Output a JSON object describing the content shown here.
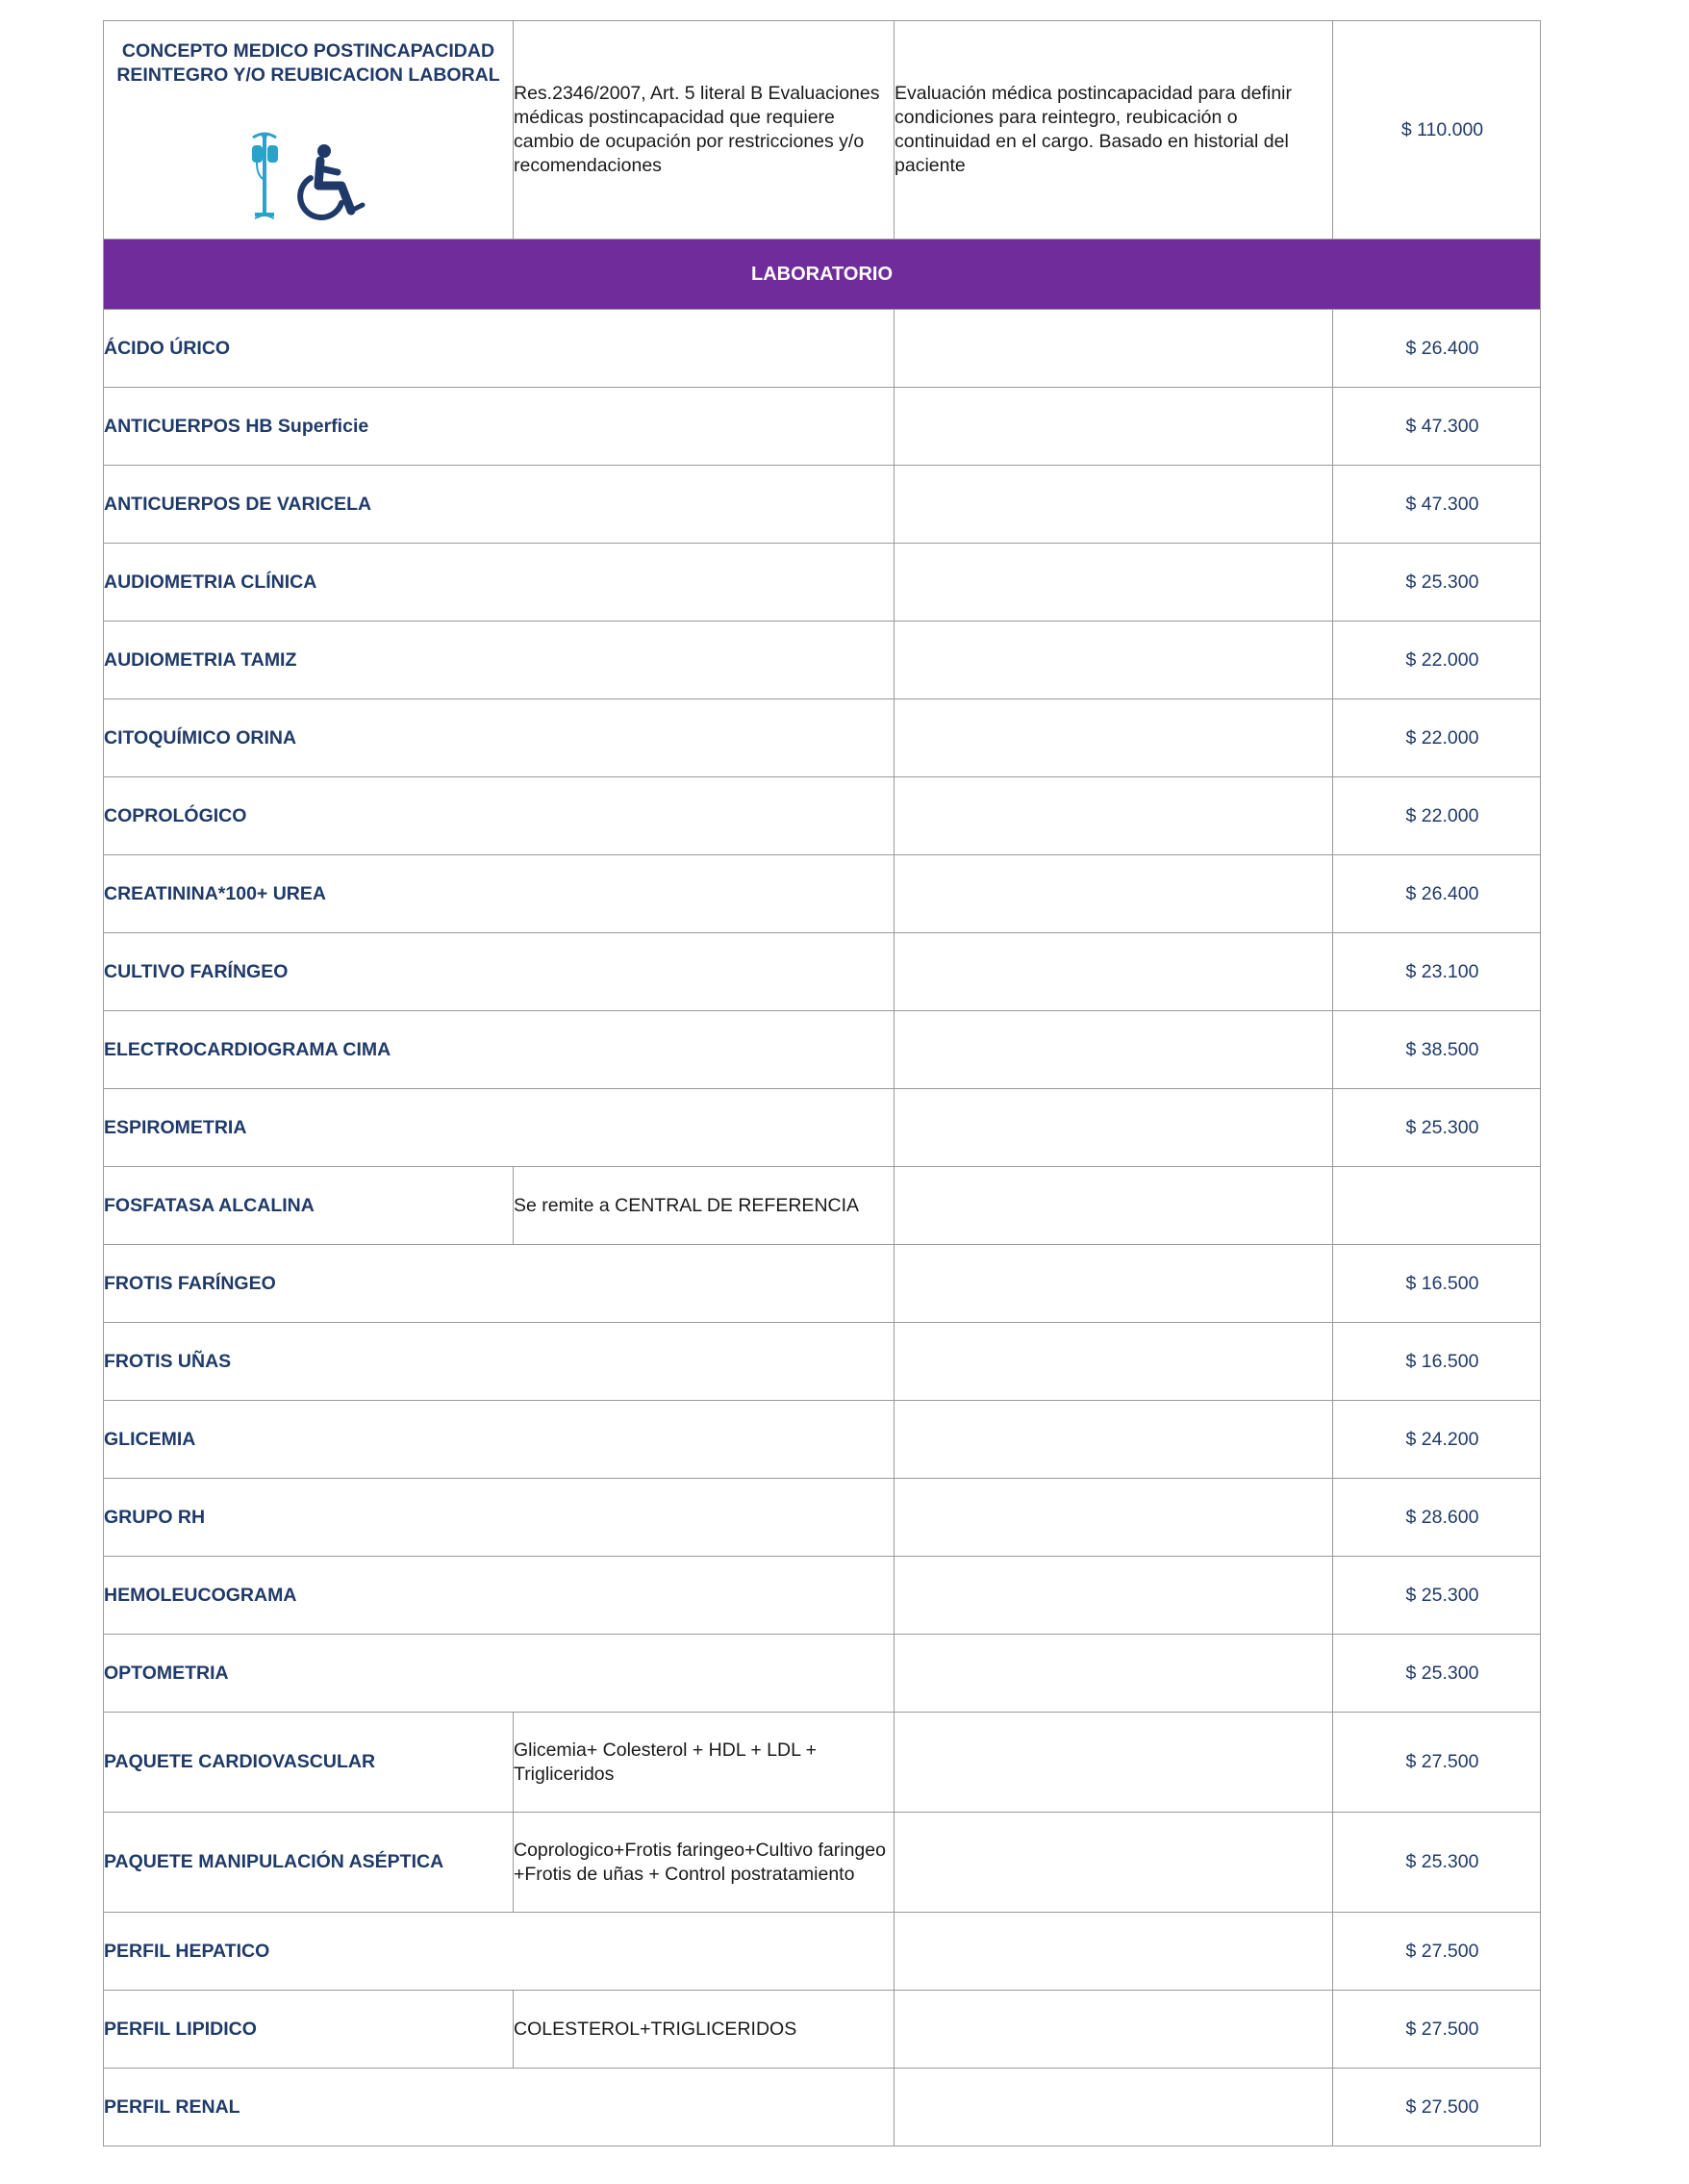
{
  "concept": {
    "title": "CONCEPTO MEDICO POSTINCAPACIDAD REINTEGRO Y/O REUBICACION LABORAL",
    "regulation": "Res.2346/2007, Art. 5 literal B Evaluaciones médicas postincapacidad que requiere cambio de ocupación por restricciones y/o recomendaciones",
    "description": "Evaluación médica postincapacidad para definir condiciones para reintegro, reubicación o continuidad en el cargo. Basado en historial del paciente",
    "price": "$ 110.000",
    "icons": [
      "iv-drip-icon",
      "wheelchair-icon"
    ]
  },
  "section": {
    "title": "LABORATORIO",
    "color": "#6f2c9a"
  },
  "items": [
    {
      "name": "ÁCIDO ÚRICO",
      "note": "",
      "price": "$ 26.400"
    },
    {
      "name": "ANTICUERPOS HB Superficie",
      "note": "",
      "price": "$ 47.300"
    },
    {
      "name": "ANTICUERPOS DE VARICELA",
      "note": "",
      "price": "$ 47.300"
    },
    {
      "name": "AUDIOMETRIA CLÍNICA",
      "note": "",
      "price": "$ 25.300"
    },
    {
      "name": "AUDIOMETRIA TAMIZ",
      "note": "",
      "price": "$ 22.000"
    },
    {
      "name": "CITOQUÍMICO ORINA",
      "note": "",
      "price": "$ 22.000"
    },
    {
      "name": "COPROLÓGICO",
      "note": "",
      "price": "$ 22.000"
    },
    {
      "name": "CREATININA*100+ UREA",
      "note": "",
      "price": "$ 26.400"
    },
    {
      "name": "CULTIVO FARÍNGEO",
      "note": "",
      "price": "$ 23.100"
    },
    {
      "name": "ELECTROCARDIOGRAMA  CIMA",
      "note": "",
      "price": "$ 38.500"
    },
    {
      "name": "ESPIROMETRIA",
      "note": "",
      "price": "$ 25.300"
    },
    {
      "name": "FOSFATASA  ALCALINA",
      "note": "Se remite a CENTRAL DE REFERENCIA",
      "price": ""
    },
    {
      "name": "FROTIS FARÍNGEO",
      "note": "",
      "price": "$ 16.500"
    },
    {
      "name": "FROTIS UÑAS",
      "note": "",
      "price": "$ 16.500"
    },
    {
      "name": "GLICEMIA",
      "note": "",
      "price": "$ 24.200"
    },
    {
      "name": "GRUPO RH",
      "note": "",
      "price": "$ 28.600"
    },
    {
      "name": "HEMOLEUCOGRAMA",
      "note": "",
      "price": "$ 25.300"
    },
    {
      "name": "OPTOMETRIA",
      "note": "",
      "price": "$ 25.300"
    },
    {
      "name": "PAQUETE CARDIOVASCULAR",
      "note": "Glicemia+ Colesterol + HDL + LDL + Trigliceridos",
      "price": "$ 27.500"
    },
    {
      "name": "PAQUETE MANIPULACIÓN ASÉPTICA",
      "note": "Coprologico+Frotis faringeo+Cultivo faringeo +Frotis de uñas + Control postratamiento",
      "price": "$ 25.300"
    },
    {
      "name": "PERFIL HEPATICO",
      "note": "",
      "price": "$ 27.500"
    },
    {
      "name": "PERFIL LIPIDICO",
      "note": "COLESTEROL+TRIGLICERIDOS",
      "price": "$ 27.500"
    },
    {
      "name": "PERFIL RENAL",
      "note": "",
      "price": "$ 27.500"
    }
  ]
}
